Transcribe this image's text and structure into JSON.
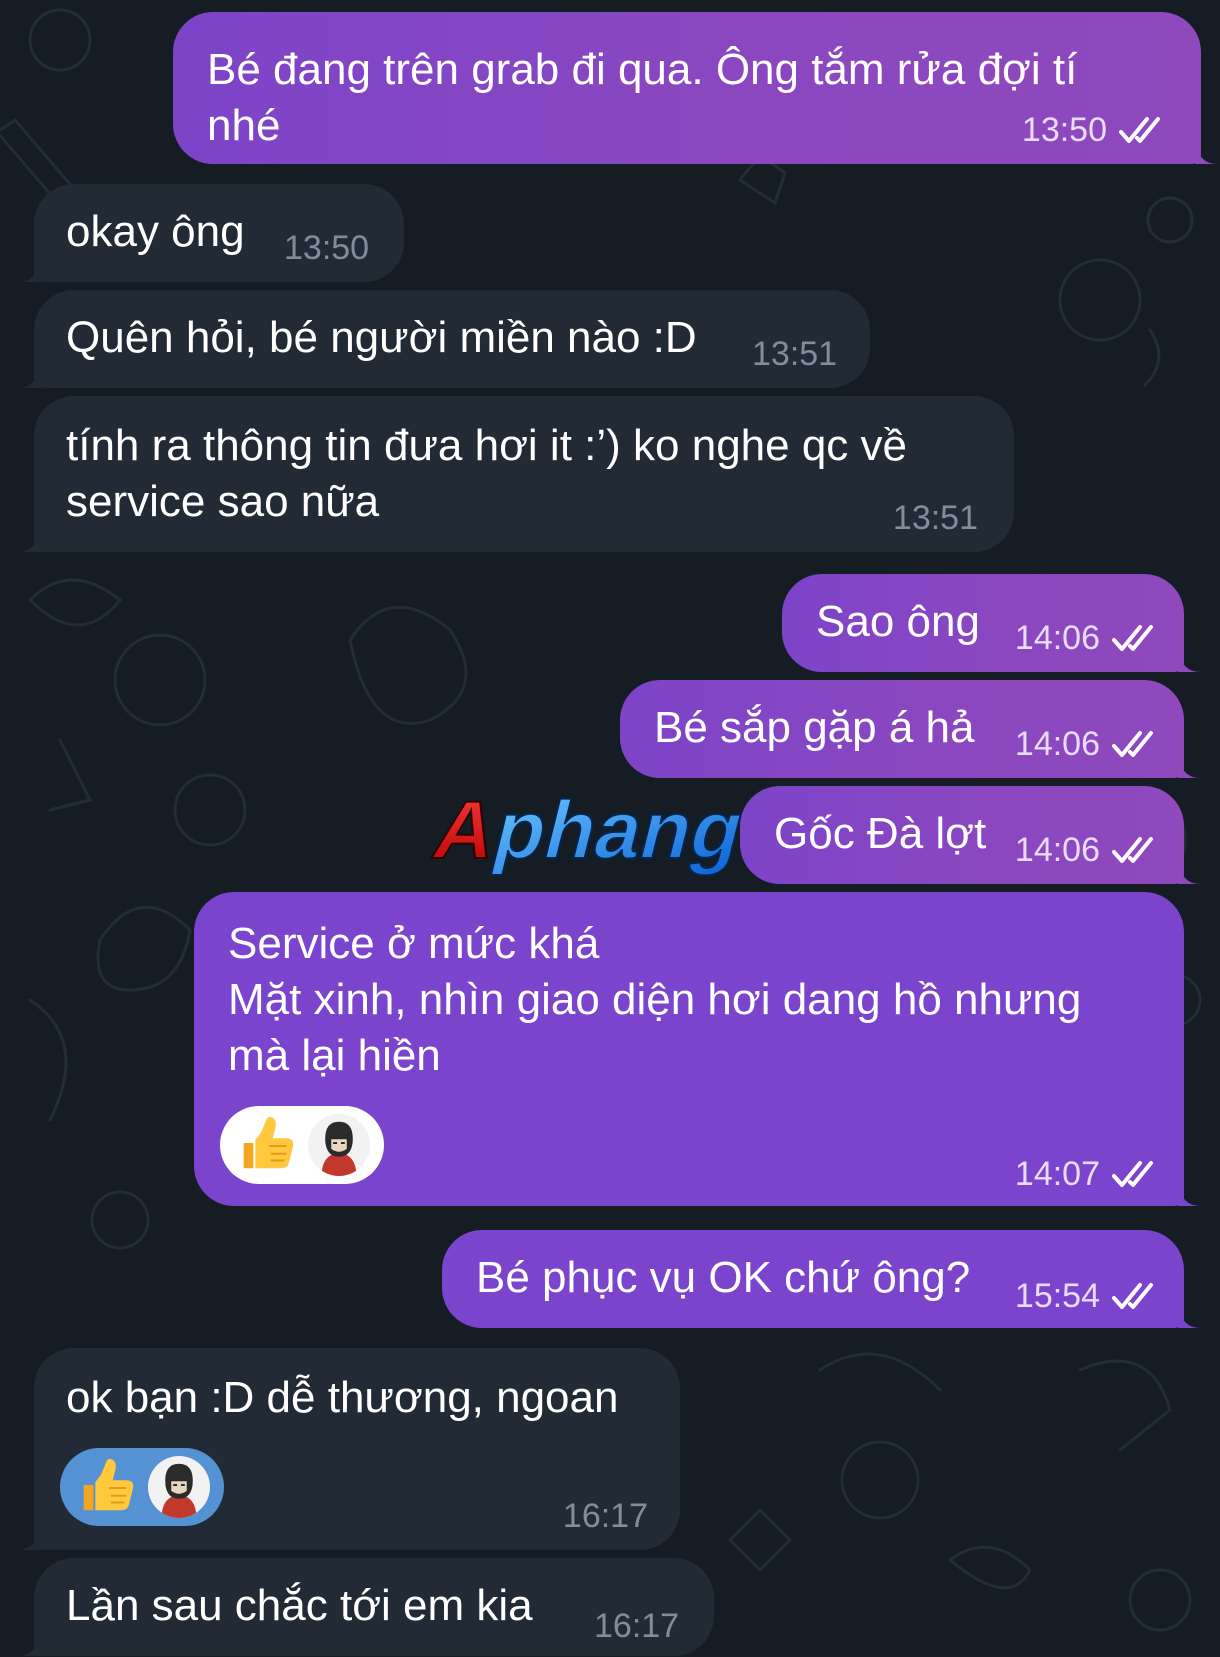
{
  "theme": {
    "background": "#151c24",
    "outgoing_bubble": "#8a47c0",
    "incoming_bubble": "#222b35",
    "read_ticks": "#ffffff"
  },
  "watermark": {
    "text": "Aphang",
    "icon": "brand-logo"
  },
  "messages": [
    {
      "direction": "outgoing",
      "text": "Bé đang trên grab đi qua. Ông tắm rửa đợi tí\nnhé",
      "time": "13:50",
      "status": "read"
    },
    {
      "direction": "incoming",
      "text": "okay ông",
      "time": "13:50"
    },
    {
      "direction": "incoming",
      "text": "Quên hỏi, bé người miền nào :D",
      "time": "13:51"
    },
    {
      "direction": "incoming",
      "text": "tính ra thông tin đưa hơi it :’) ko nghe qc về\nservice sao nữa",
      "time": "13:51"
    },
    {
      "direction": "outgoing",
      "text": "Sao ông",
      "time": "14:06",
      "status": "read"
    },
    {
      "direction": "outgoing",
      "text": "Bé sắp gặp á hả",
      "time": "14:06",
      "status": "read"
    },
    {
      "direction": "outgoing",
      "text": "Gốc Đà lợt",
      "time": "14:06",
      "status": "read"
    },
    {
      "direction": "outgoing",
      "text": "Service ở mức khá\nMặt xinh, nhìn giao diện hơi dang hồ nhưng\nmà lại hiền",
      "time": "14:07",
      "status": "read",
      "reaction": {
        "emoji": "thumbs-up-icon",
        "by": "avatar"
      }
    },
    {
      "direction": "outgoing",
      "text": "Bé phục vụ OK chứ ông?",
      "time": "15:54",
      "status": "read"
    },
    {
      "direction": "incoming",
      "text": "ok bạn :D dễ thương, ngoan",
      "time": "16:17",
      "reaction": {
        "emoji": "thumbs-up-icon",
        "by": "avatar"
      }
    },
    {
      "direction": "incoming",
      "text": "Lần sau chắc tới em kia",
      "time": "16:17"
    }
  ]
}
